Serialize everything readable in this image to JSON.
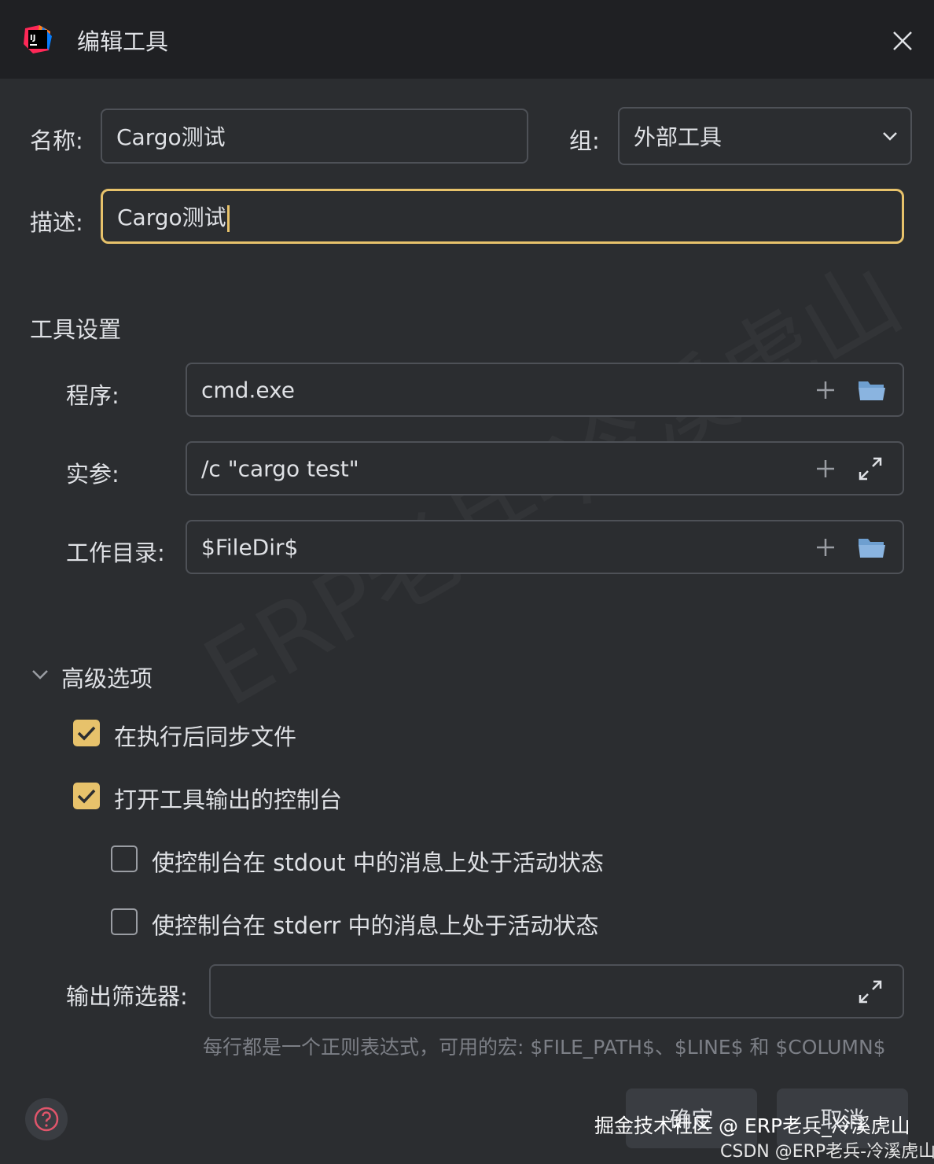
{
  "window": {
    "title": "编辑工具",
    "app_icon_text": "IJ"
  },
  "form": {
    "name_label": "名称:",
    "name_value": "Cargo测试",
    "group_label": "组:",
    "group_value": "外部工具",
    "desc_label": "描述:",
    "desc_value": "Cargo测试"
  },
  "tool_settings": {
    "heading": "工具设置",
    "program_label": "程序:",
    "program_value": "cmd.exe",
    "args_label": "实参:",
    "args_value": "/c \"cargo test\"",
    "workdir_label": "工作目录:",
    "workdir_value": "$FileDir$"
  },
  "advanced": {
    "heading": "高级选项",
    "sync_files": {
      "label": "在执行后同步文件",
      "checked": true
    },
    "open_console": {
      "label": "打开工具输出的控制台",
      "checked": true
    },
    "activate_stdout": {
      "label": "使控制台在 stdout 中的消息上处于活动状态",
      "checked": false
    },
    "activate_stderr": {
      "label": "使控制台在 stderr 中的消息上处于活动状态",
      "checked": false
    },
    "output_filters_label": "输出筛选器:",
    "output_filters_value": "",
    "hint": "每行都是一个正则表达式，可用的宏: $FILE_PATH$、$LINE$ 和 $COLUMN$"
  },
  "buttons": {
    "ok": "确定",
    "cancel": "取消"
  },
  "watermarks": {
    "line1": "掘金技术社区 @ ERP老兵_冷溪虎山",
    "line2": "CSDN @ERP老兵-冷溪虎山",
    "diagonal": "ERP老兵-冷溪虎山"
  },
  "colors": {
    "accent": "#e7c26b",
    "background": "#2b2d30",
    "titlebar": "#1f2023",
    "border": "#4e5157"
  },
  "icons": [
    "intellij-icon",
    "close-icon",
    "chevron-down-icon",
    "plus-icon",
    "folder-icon",
    "expand-icon",
    "help-icon"
  ]
}
